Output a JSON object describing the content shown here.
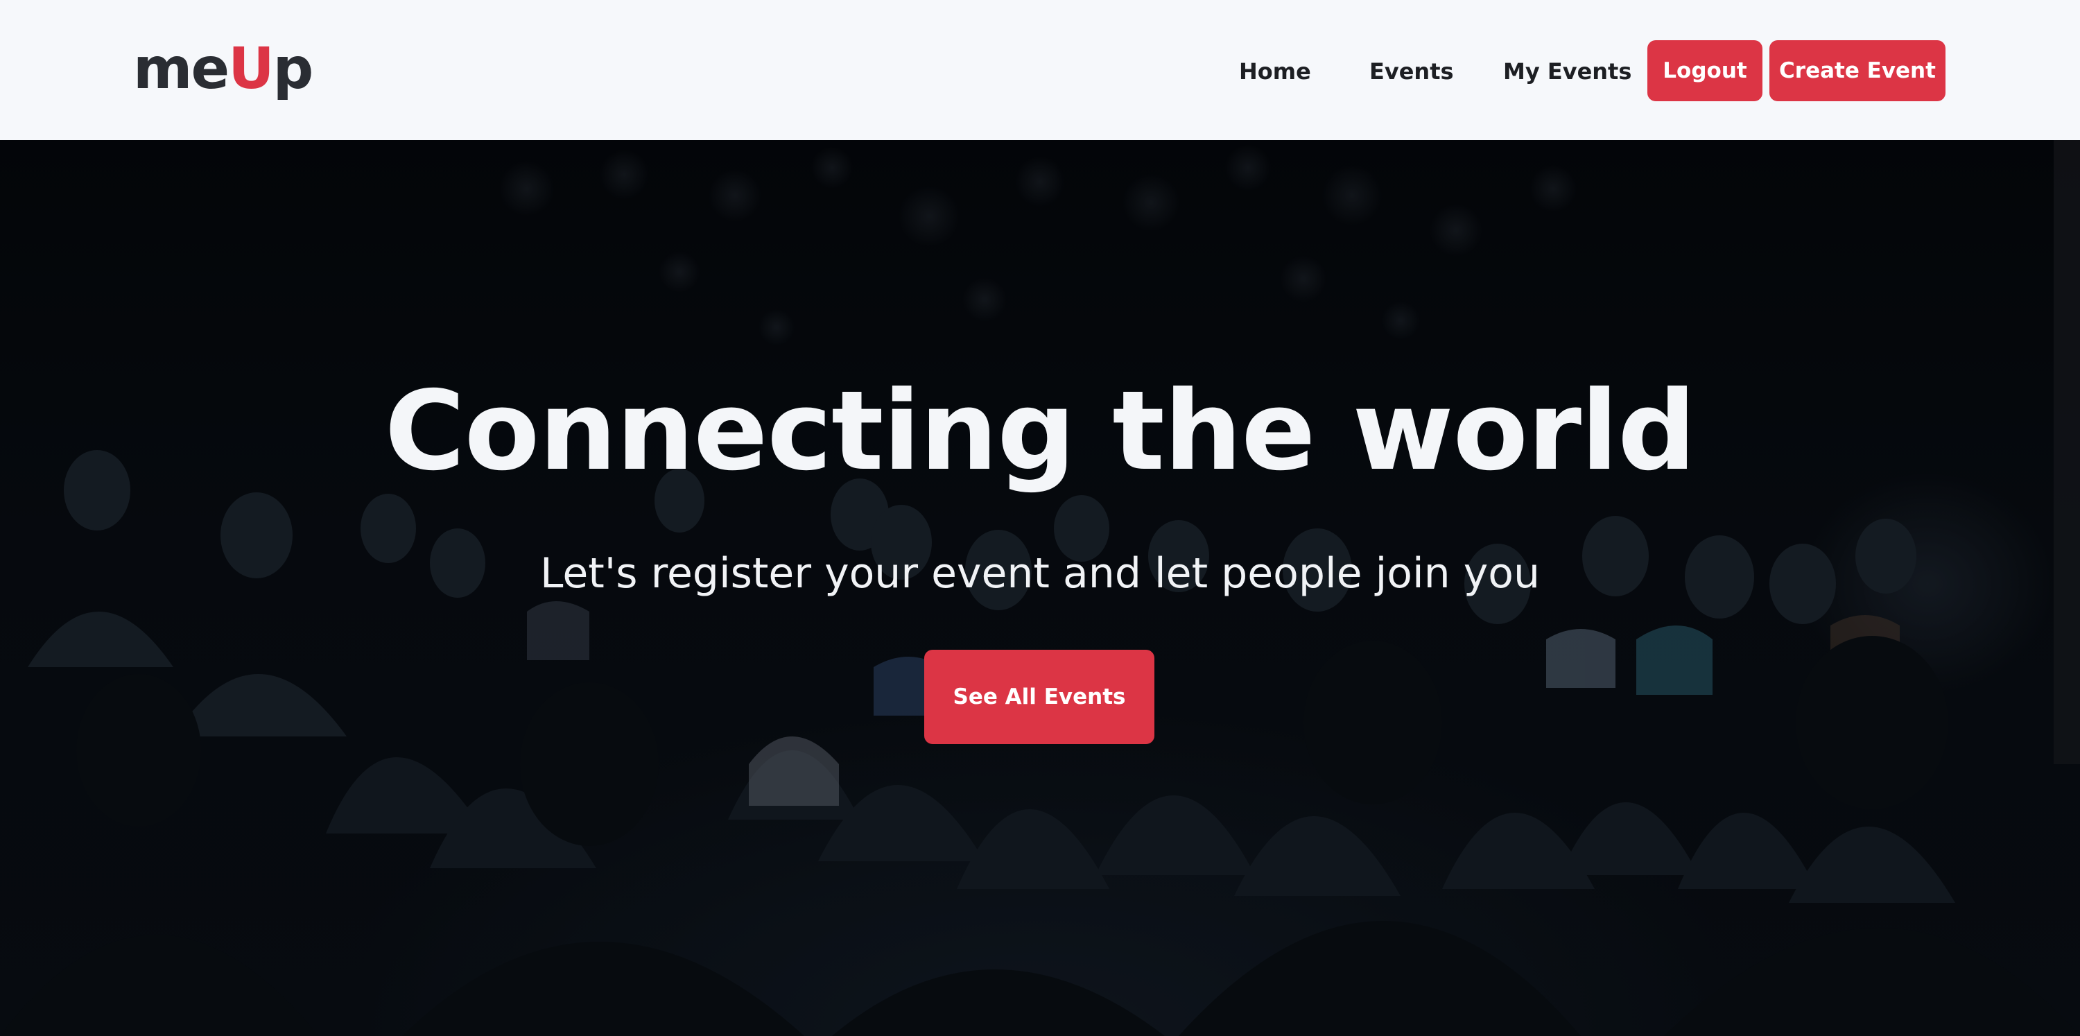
{
  "brand": {
    "prefix": "me",
    "accent": "U",
    "suffix": "p"
  },
  "nav": {
    "links": [
      "Home",
      "Events",
      "My Events"
    ],
    "logout_label": "Logout",
    "create_label": "Create Event"
  },
  "hero": {
    "title": "Connecting the world",
    "subtitle": "Let's register your event and let people join you",
    "cta_label": "See All Events"
  },
  "colors": {
    "accent": "#dc3545",
    "navbar_bg": "#f6f8fb",
    "brand_text": "#2a2d33",
    "hero_text": "#f4f6f9"
  }
}
